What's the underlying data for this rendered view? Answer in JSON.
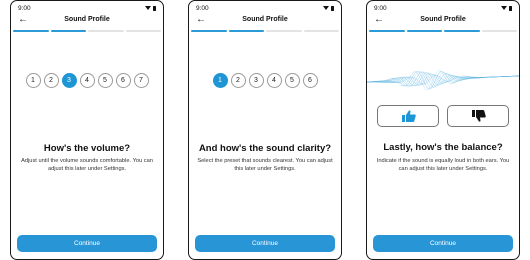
{
  "common": {
    "time": "9:00",
    "back": "←",
    "title": "Sound Profile",
    "continue_label": "Continue",
    "accent_color": "#2896d6"
  },
  "screens": [
    {
      "progress_filled": 2,
      "progress_total": 4,
      "steps": [
        "1",
        "2",
        "3",
        "4",
        "5",
        "6",
        "7"
      ],
      "selected_step": "3",
      "heading": "How's the volume?",
      "description": "Adjust until the volume sounds comfortable. You can adjust this later under Settings."
    },
    {
      "progress_filled": 2,
      "progress_total": 4,
      "steps": [
        "1",
        "2",
        "3",
        "4",
        "5",
        "6"
      ],
      "selected_step": "1",
      "heading": "And how's the sound clarity?",
      "description": "Select the preset that sounds clearest. You can adjust this later under Settings."
    },
    {
      "progress_filled": 3,
      "progress_total": 4,
      "thumbs_up_icon": "thumbs-up-icon",
      "thumbs_down_icon": "thumbs-down-icon",
      "heading": "Lastly, how's the balance?",
      "description": "Indicate if the sound is equally loud in both ears. You can adjust this later under Settings."
    }
  ]
}
